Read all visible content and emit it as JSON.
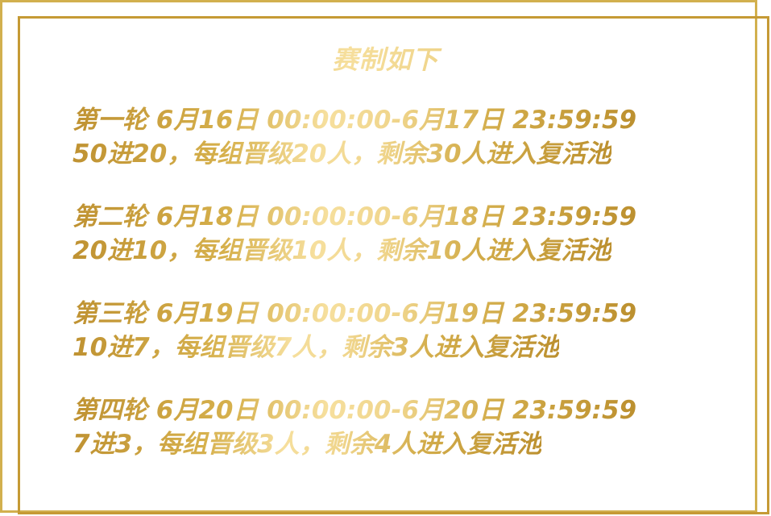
{
  "title": "赛制如下",
  "rounds": [
    {
      "schedule": "第一轮 6月16日 00:00:00-6月17日 23:59:59",
      "rule": "50进20，每组晋级20人，剩余30人进入复活池"
    },
    {
      "schedule": "第二轮 6月18日 00:00:00-6月18日 23:59:59",
      "rule": "20进10，每组晋级10人，剩余10人进入复活池"
    },
    {
      "schedule": "第三轮 6月19日 00:00:00-6月19日 23:59:59",
      "rule": "10进7，每组晋级7人，剩余3人进入复活池"
    },
    {
      "schedule": "第四轮 6月20日 00:00:00-6月20日 23:59:59",
      "rule": "7进3，每组晋级3人，剩余4人进入复活池"
    }
  ],
  "colors": {
    "gold_dark": "#bf9232",
    "gold_light": "#f6df9d",
    "frame": "#c9a23f"
  }
}
